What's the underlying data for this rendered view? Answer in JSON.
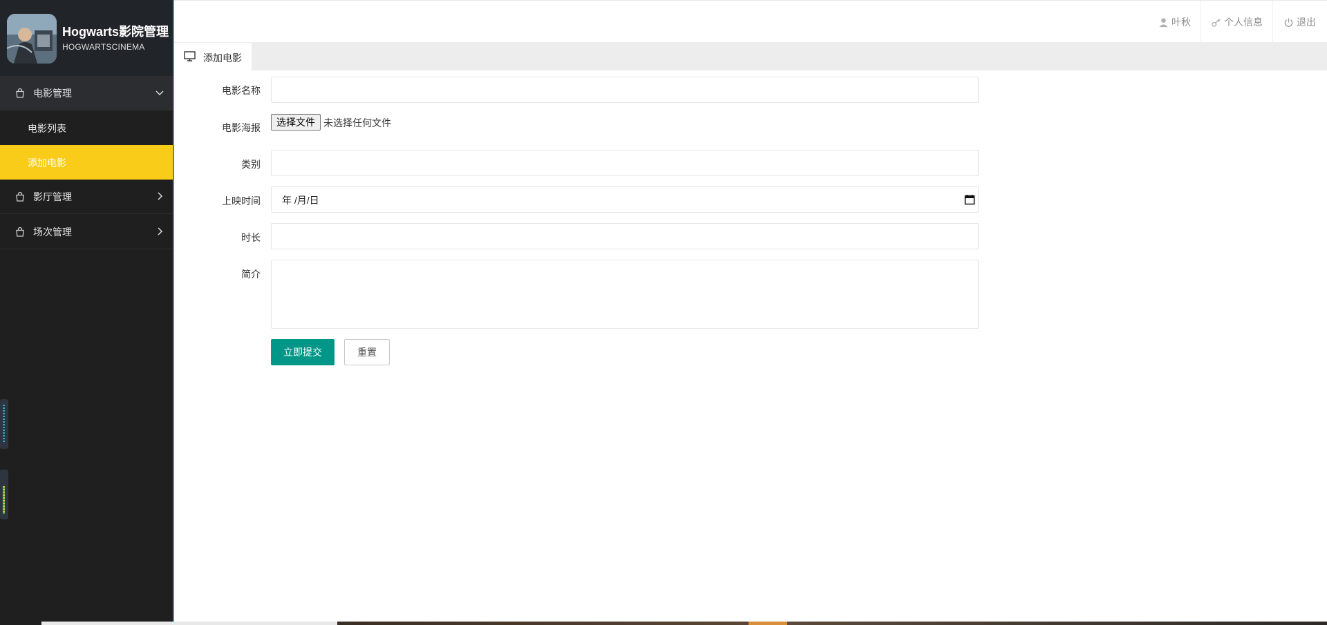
{
  "brand": {
    "title": "Hogwarts影院管理",
    "subtitle": "HOGWARTSCINEMA"
  },
  "sidebar": {
    "groups": [
      {
        "label": "电影管理",
        "icon": "bag-icon",
        "expanded": true
      },
      {
        "label": "影厅管理",
        "icon": "bag-icon",
        "expanded": false
      },
      {
        "label": "场次管理",
        "icon": "bag-icon",
        "expanded": false
      }
    ],
    "subitems": [
      {
        "label": "电影列表",
        "active": false
      },
      {
        "label": "添加电影",
        "active": true
      }
    ],
    "active_color": "#f9cc1a",
    "background": "#1f1f1f"
  },
  "header": {
    "user_name": "叶秋",
    "profile_label": "个人信息",
    "logout_label": "退出"
  },
  "tabs": [
    {
      "label": "添加电影",
      "icon": "monitor-icon"
    }
  ],
  "form": {
    "name_label": "电影名称",
    "poster_label": "电影海报",
    "file_button": "选择文件",
    "file_status": "未选择任何文件",
    "category_label": "类别",
    "release_label": "上映时间",
    "release_placeholder": "年 /月/日",
    "duration_label": "时长",
    "intro_label": "简介",
    "submit_label": "立即提交",
    "reset_label": "重置"
  },
  "colors": {
    "primary": "#009688",
    "accent": "#f9cc1a"
  }
}
